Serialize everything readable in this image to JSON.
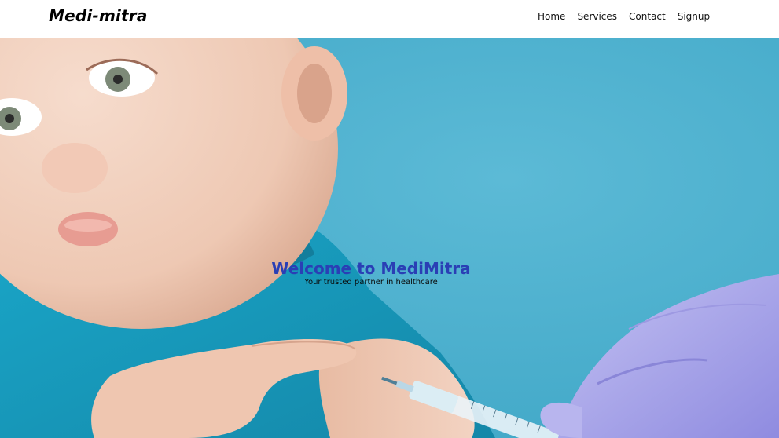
{
  "navbar": {
    "brand": "Medi-mitra",
    "links": [
      "Home",
      "Services",
      "Contact",
      "Signup"
    ]
  },
  "hero": {
    "title": "Welcome to MediMitra",
    "subtitle": "Your trusted partner in healthcare",
    "image_alt": "child-receiving-vaccination-photo"
  },
  "colors": {
    "hero_background": "#4eb0cf",
    "title_color": "#2a3fb5",
    "shirt_color": "#1fa3c4",
    "glove_color": "#a9a6e8"
  }
}
